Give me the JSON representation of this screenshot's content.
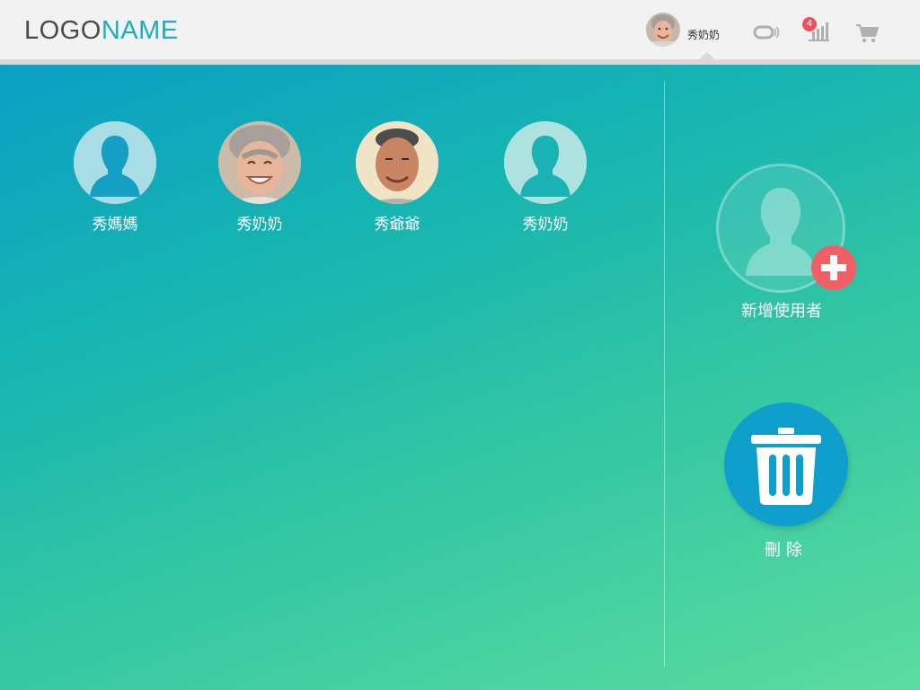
{
  "header": {
    "logo_part1": "LOGO",
    "logo_part2": "NAME",
    "current_user": {
      "name": "秀奶奶",
      "avatar": "grandma-photo"
    },
    "icons": [
      "connection-icon",
      "statistics-icon",
      "cart-icon"
    ],
    "notification_count": "4"
  },
  "users": [
    {
      "name": "秀媽媽",
      "avatar": "default-silhouette"
    },
    {
      "name": "秀奶奶",
      "avatar": "grandma-photo"
    },
    {
      "name": "秀爺爺",
      "avatar": "grandpa-photo"
    },
    {
      "name": "秀奶奶",
      "avatar": "default-silhouette"
    }
  ],
  "actions": {
    "add_user_label": "新增使用者",
    "delete_label": "刪除"
  },
  "colors": {
    "logo_accent": "#1aaec2",
    "add_button": "#ef5f63",
    "delete_button": "#0f9fcd",
    "badge": "#ef4f5d"
  }
}
